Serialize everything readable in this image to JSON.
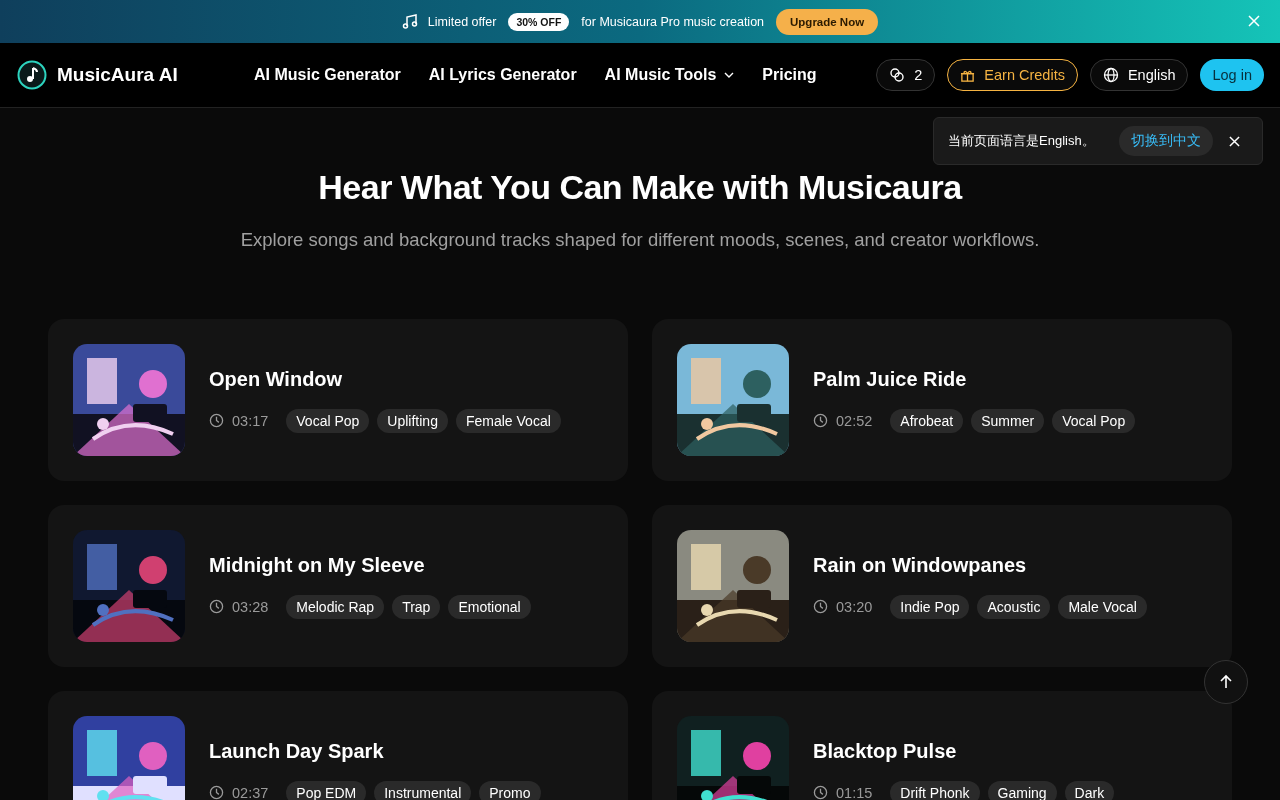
{
  "promo_banner": {
    "text_before": "Limited offer",
    "badge": "30% OFF",
    "text_after": "for Musicaura Pro music creation",
    "button": "Upgrade Now"
  },
  "header": {
    "logo": "MusicAura AI",
    "nav": [
      {
        "label": "AI Music Generator",
        "dropdown": false
      },
      {
        "label": "AI Lyrics Generator",
        "dropdown": false
      },
      {
        "label": "AI Music Tools",
        "dropdown": true
      },
      {
        "label": "Pricing",
        "dropdown": false
      }
    ],
    "credits": "2",
    "earn_button": "Earn Credits",
    "language": "English",
    "login": "Log in"
  },
  "language_notice": {
    "text": "当前页面语言是English。",
    "switch_button": "切换到中文"
  },
  "section": {
    "title": "Hear What You Can Make with Musicaura",
    "subtitle": "Explore songs and background tracks shaped for different moods, scenes, and creator workflows."
  },
  "tracks": [
    {
      "title": "Open Window",
      "duration": "03:17",
      "tags": [
        "Vocal Pop",
        "Uplifting",
        "Female Vocal"
      ]
    },
    {
      "title": "Palm Juice Ride",
      "duration": "02:52",
      "tags": [
        "Afrobeat",
        "Summer",
        "Vocal Pop"
      ]
    },
    {
      "title": "Midnight on My Sleeve",
      "duration": "03:28",
      "tags": [
        "Melodic Rap",
        "Trap",
        "Emotional"
      ]
    },
    {
      "title": "Rain on Windowpanes",
      "duration": "03:20",
      "tags": [
        "Indie Pop",
        "Acoustic",
        "Male Vocal"
      ]
    },
    {
      "title": "Launch Day Spark",
      "duration": "02:37",
      "tags": [
        "Pop EDM",
        "Instrumental",
        "Promo"
      ]
    },
    {
      "title": "Blacktop Pulse",
      "duration": "01:15",
      "tags": [
        "Drift Phonk",
        "Gaming",
        "Dark"
      ]
    }
  ]
}
